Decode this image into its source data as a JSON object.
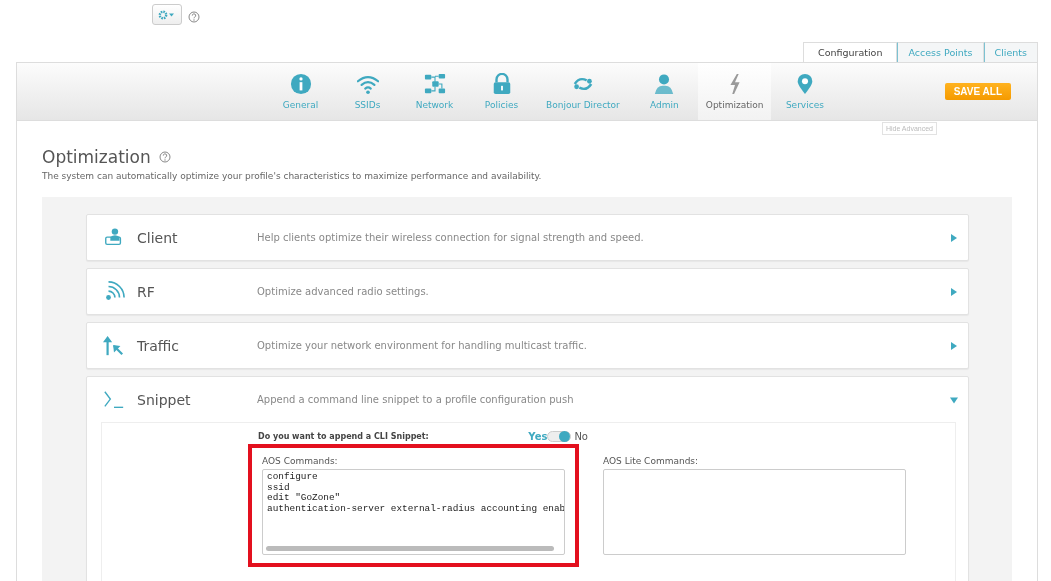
{
  "top_tabs": [
    {
      "label": "Configuration",
      "selected": true
    },
    {
      "label": "Access Points",
      "selected": false
    },
    {
      "label": "Clients",
      "selected": false
    }
  ],
  "nav": [
    {
      "label": "General",
      "kind": "info",
      "selected": false
    },
    {
      "label": "SSIDs",
      "kind": "wifi",
      "selected": false
    },
    {
      "label": "Network",
      "kind": "network",
      "selected": false
    },
    {
      "label": "Policies",
      "kind": "lock",
      "selected": false
    },
    {
      "label": "Bonjour Director",
      "kind": "bonjour",
      "selected": false
    },
    {
      "label": "Admin",
      "kind": "user",
      "selected": false
    },
    {
      "label": "Optimization",
      "kind": "bolt",
      "selected": true
    },
    {
      "label": "Services",
      "kind": "pin",
      "selected": false
    }
  ],
  "save_button": "SAVE ALL",
  "hide_advanced": "Hide Advanced",
  "page": {
    "title": "Optimization",
    "description": "The system can automatically optimize your profile's characteristics to maximize performance and availability."
  },
  "sections": [
    {
      "kind": "client",
      "title": "Client",
      "description": "Help clients optimize their wireless connection for signal strength and speed.",
      "expanded": false
    },
    {
      "kind": "rf",
      "title": "RF",
      "description": "Optimize advanced radio settings.",
      "expanded": false
    },
    {
      "kind": "traffic",
      "title": "Traffic",
      "description": "Optimize your network environment for handling multicast traffic.",
      "expanded": false
    },
    {
      "kind": "snippet",
      "title": "Snippet",
      "description": "Append a command line snippet to a profile configuration push",
      "expanded": true
    }
  ],
  "snippet": {
    "question": "Do you want to append a CLI Snippet:",
    "yes_label": "Yes",
    "no_label": "No",
    "on": true,
    "fields": [
      {
        "label": "AOS Commands:",
        "highlighted": true,
        "lines": [
          "configure",
          "ssid",
          "edit \"GoZone\"",
          "authentication-server external-radius accounting enab"
        ]
      },
      {
        "label": "AOS Lite Commands:",
        "highlighted": false
      }
    ]
  }
}
